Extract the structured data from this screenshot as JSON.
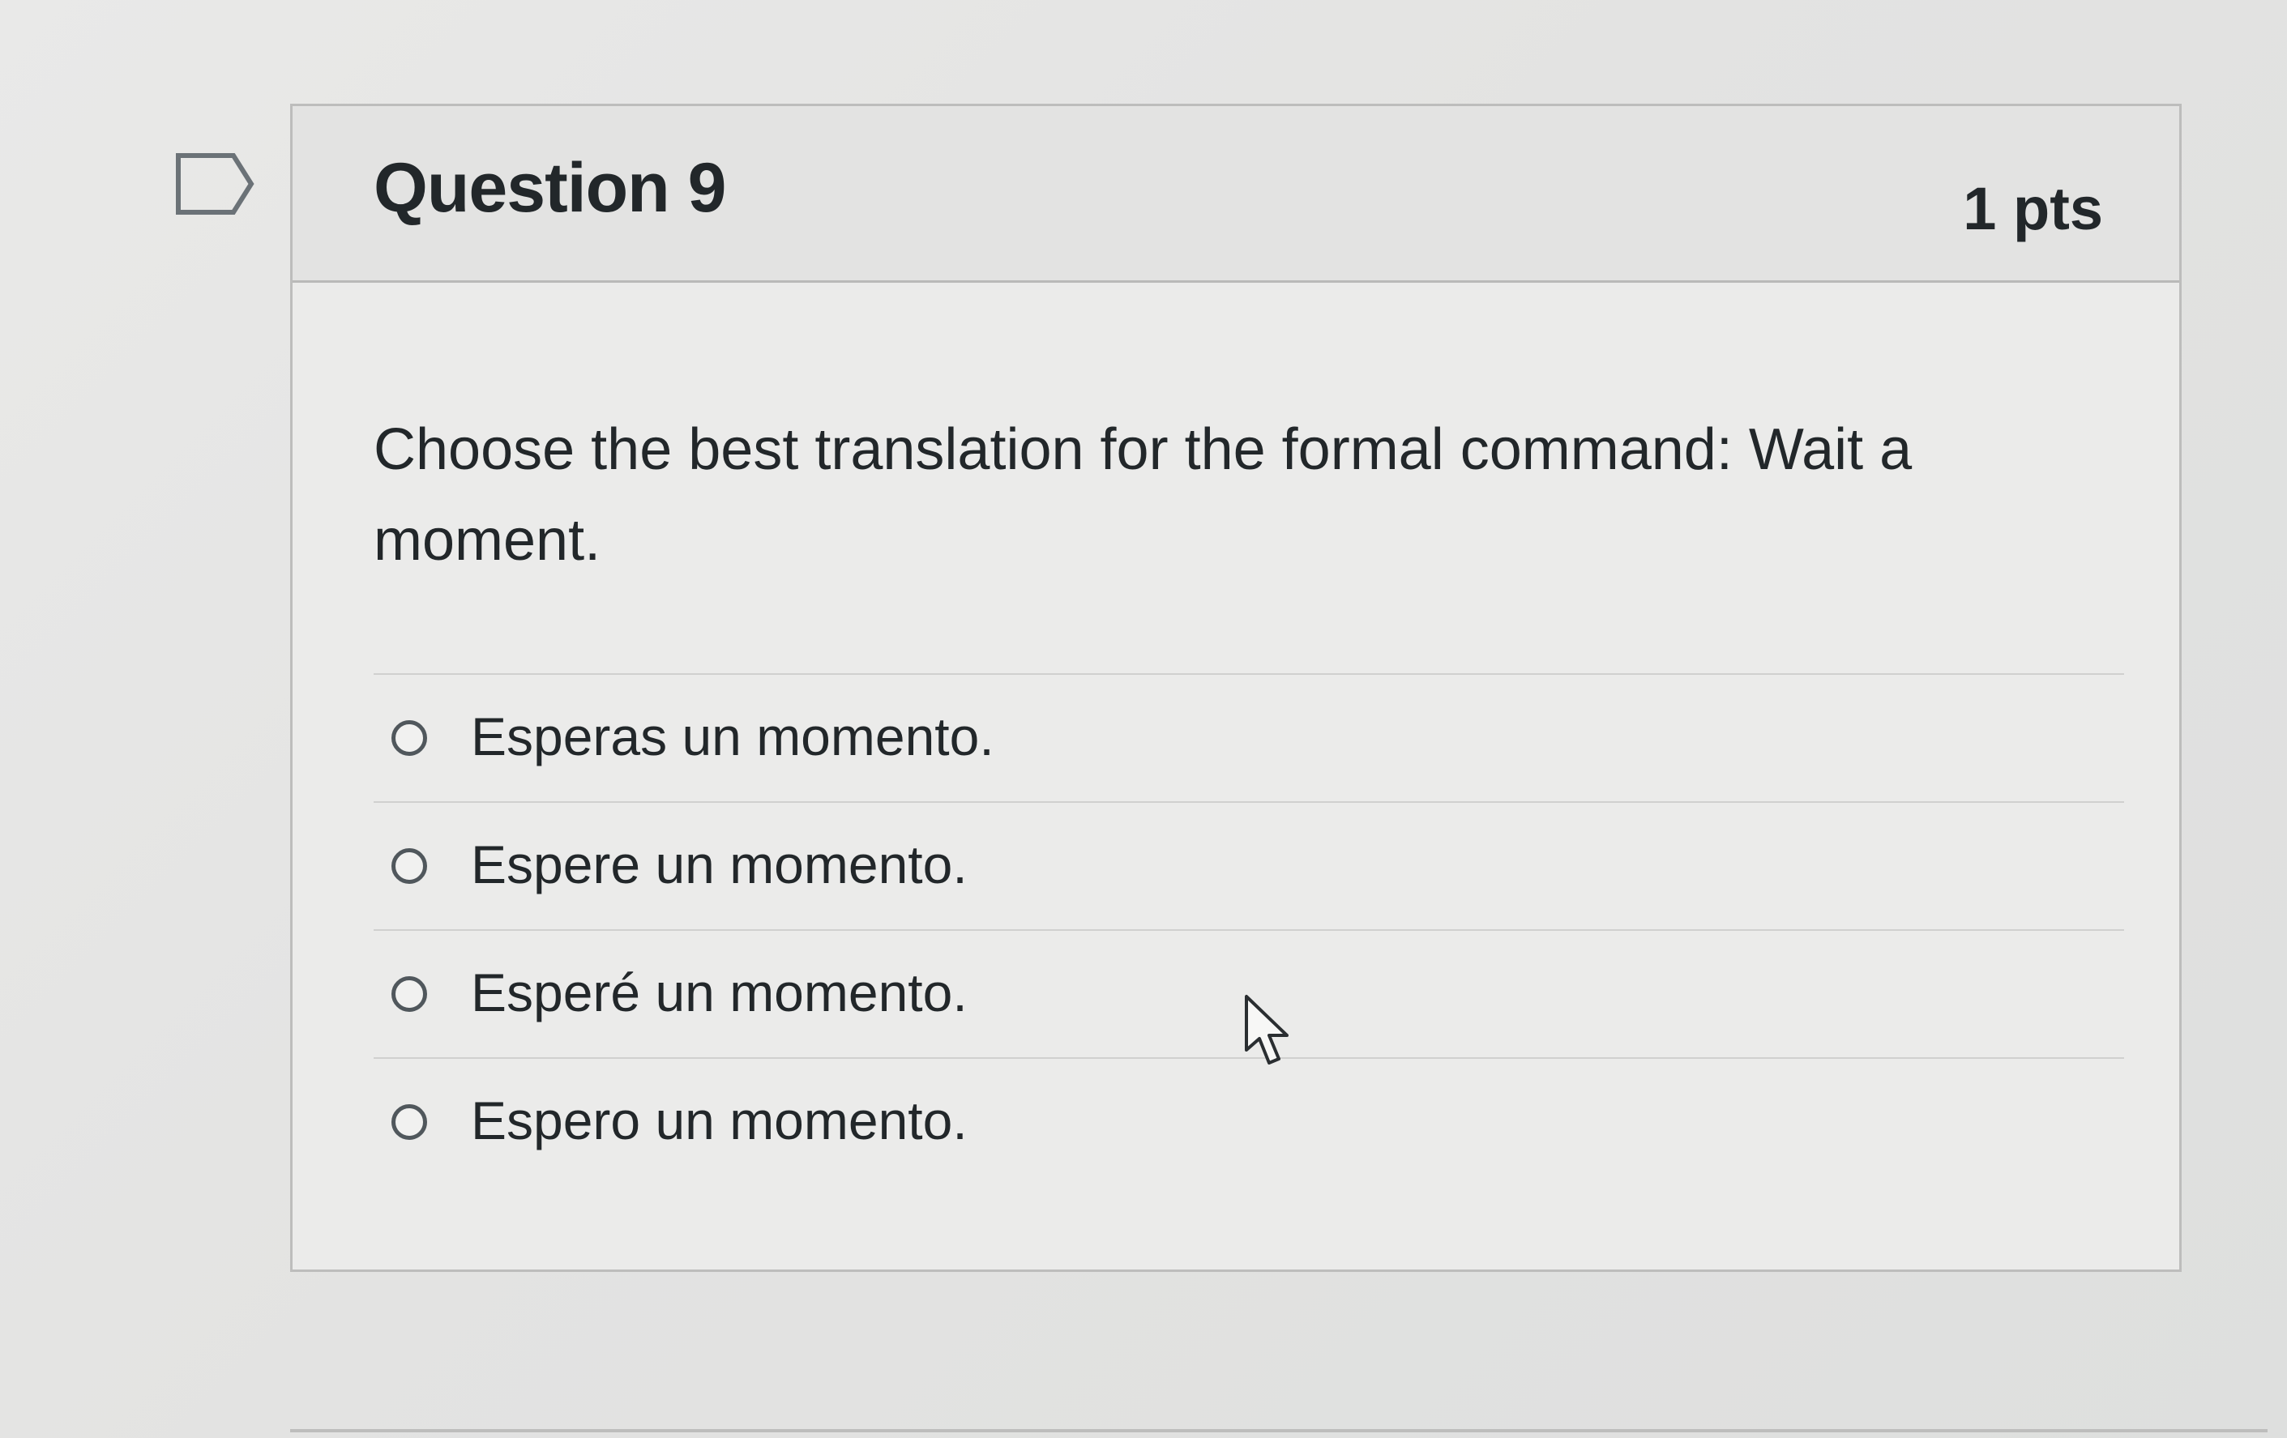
{
  "question": {
    "title": "Question 9",
    "points": "1 pts",
    "text": "Choose the best translation for the formal command: Wait a moment."
  },
  "answers": [
    {
      "label": "Esperas un momento."
    },
    {
      "label": "Espere un momento."
    },
    {
      "label": "Esperé un momento."
    },
    {
      "label": "Espero un momento."
    }
  ],
  "icons": {
    "flag": "flag-icon",
    "radio": "radio-button-icon",
    "cursor": "mouse-pointer-icon"
  },
  "colors": {
    "text": "#22272a",
    "border": "#bdbdbc",
    "header_bg": "#e3e3e2"
  }
}
